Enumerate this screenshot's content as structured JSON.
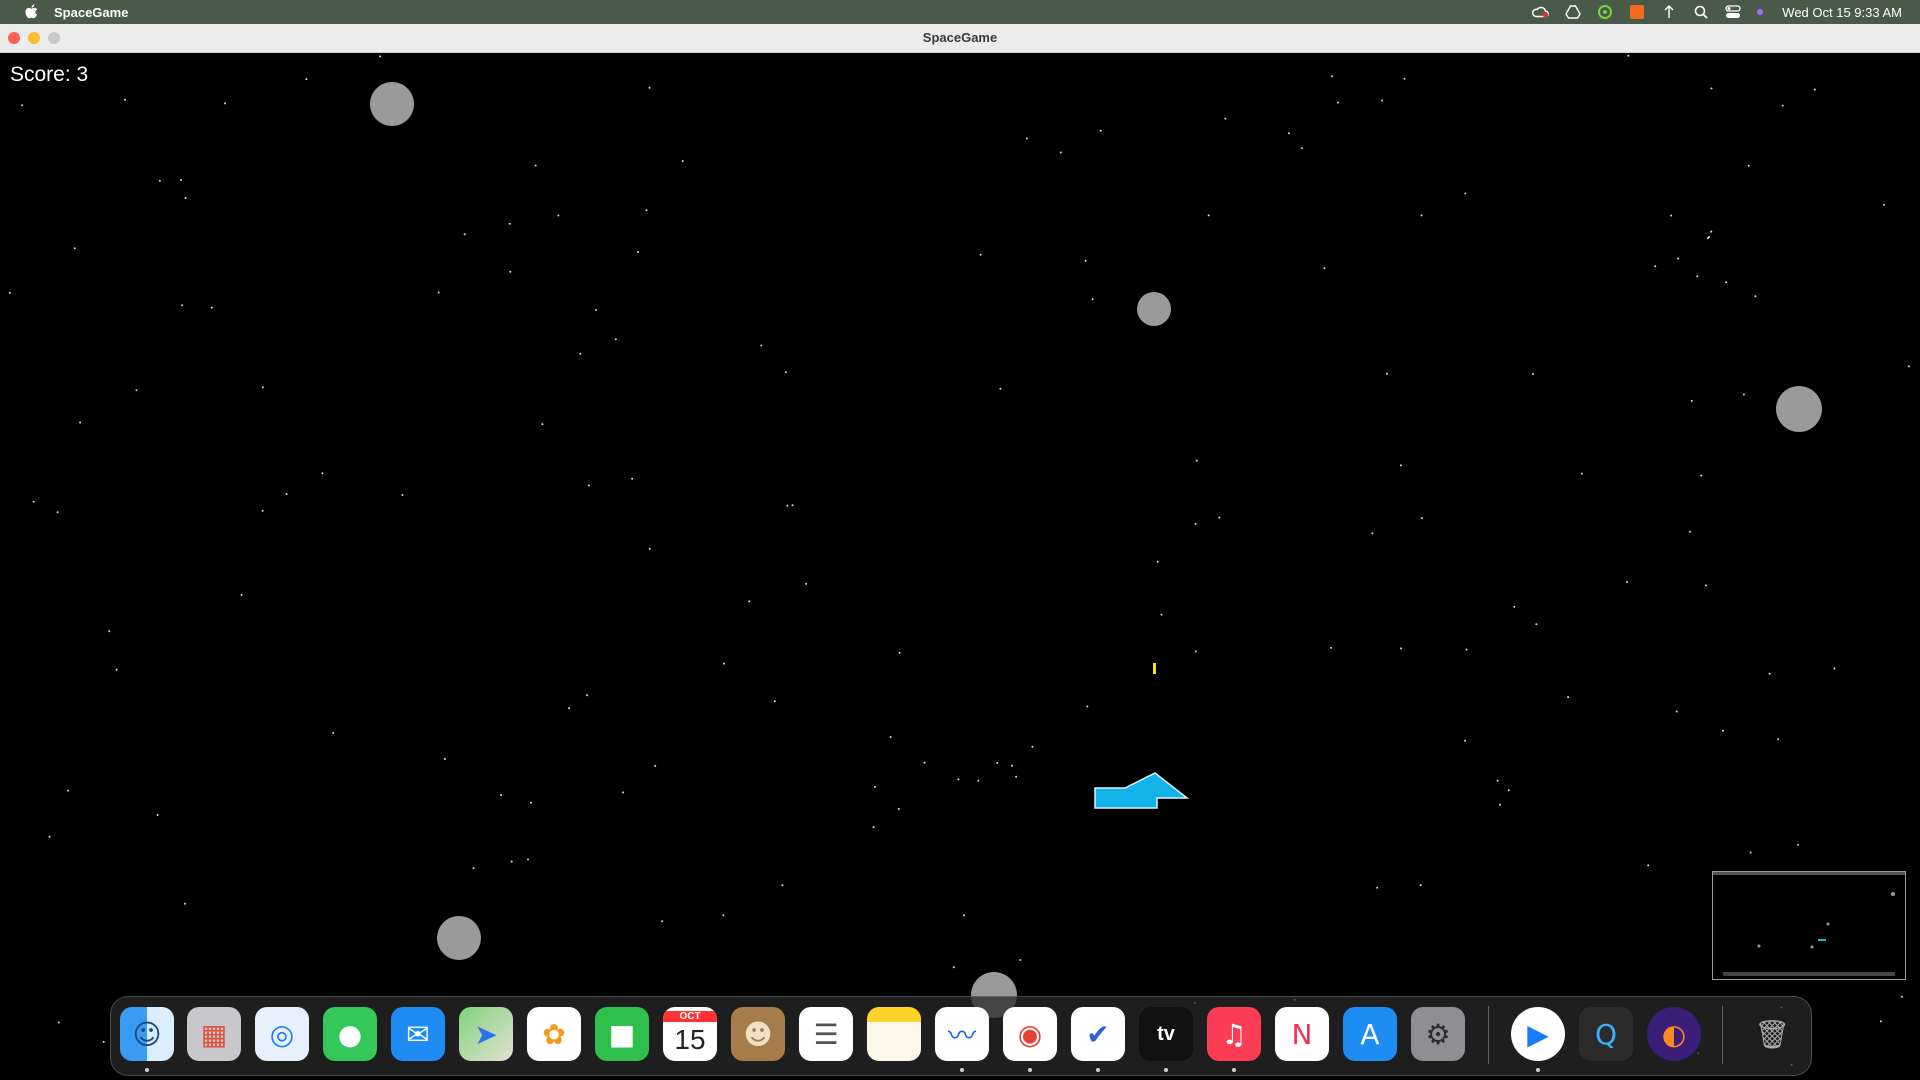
{
  "menubar": {
    "app_name": "SpaceGame",
    "datetime": "Wed Oct 15  9:33 AM",
    "icons": [
      "apple-icon",
      "creative-cloud-icon",
      "google-drive-icon",
      "sync-icon",
      "orange-app-icon",
      "network-icon",
      "search-icon",
      "control-center-icon",
      "siri-icon"
    ]
  },
  "window": {
    "title": "SpaceGame"
  },
  "game": {
    "score_label": "Score: 3",
    "score": 3
  },
  "dock": {
    "apps": [
      "finder-icon",
      "launchpad-icon",
      "safari-icon",
      "messages-icon",
      "mail-icon",
      "maps-icon",
      "photos-icon",
      "facetime-icon",
      "calendar-icon",
      "contacts-icon",
      "reminders-icon",
      "notes-icon",
      "freeform-icon",
      "chrome-icon",
      "pycharm-icon",
      "apple-tv-icon",
      "music-icon",
      "news-icon",
      "app-store-icon",
      "system-settings-icon",
      "media-player-icon",
      "quicktime-icon",
      "firefox-icon",
      "trash-icon"
    ],
    "calendar_month": "OCT",
    "calendar_day": "15",
    "tv_label": "tv"
  }
}
